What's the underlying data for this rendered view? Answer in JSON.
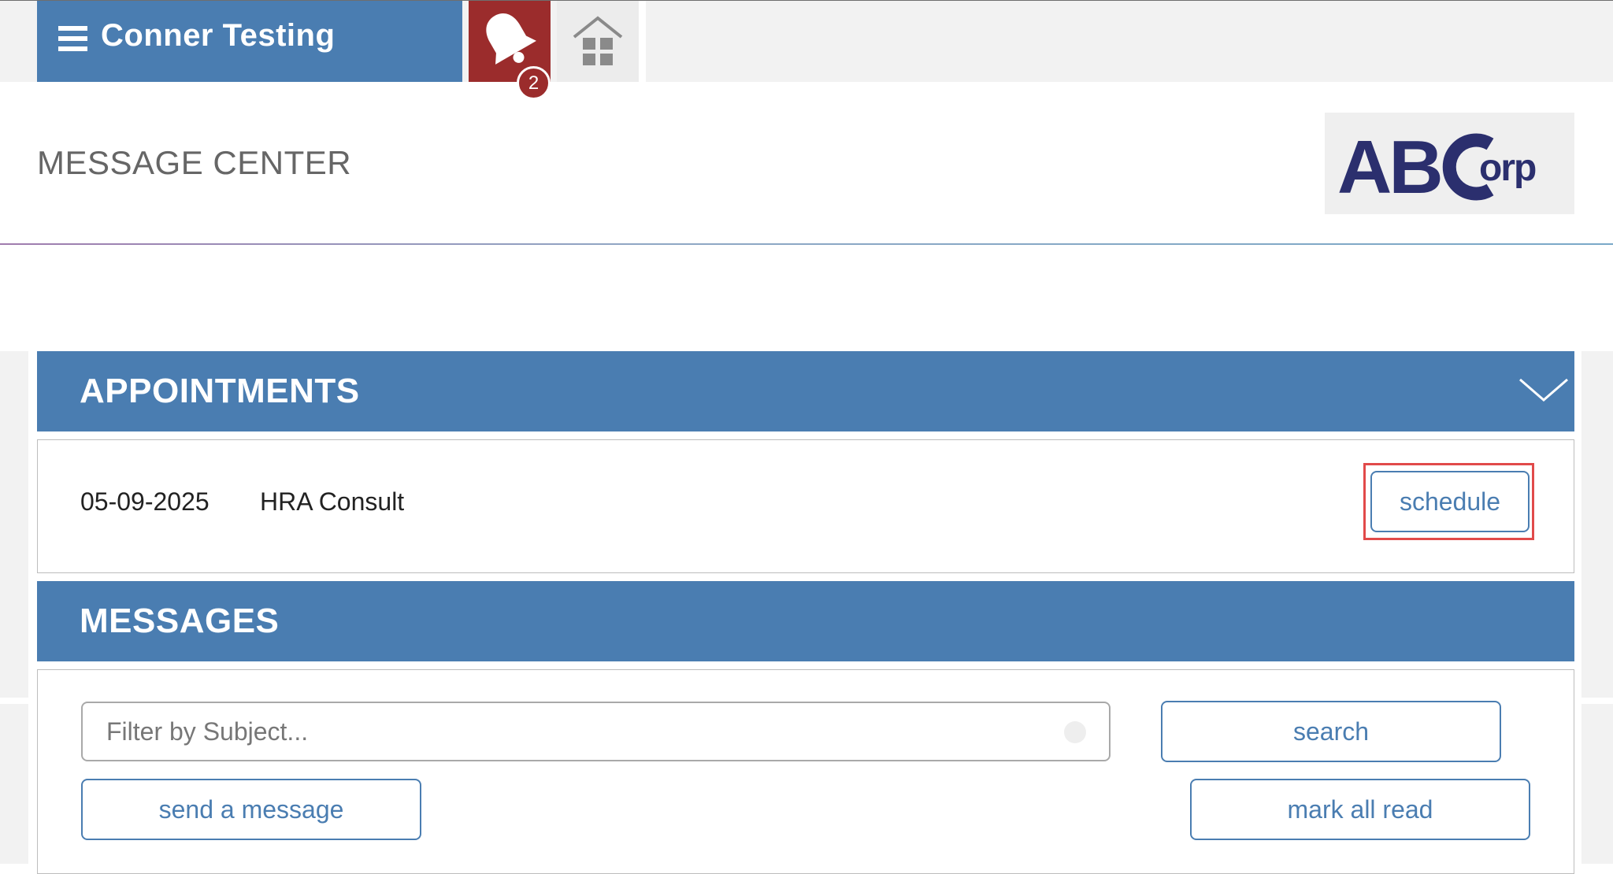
{
  "app": {
    "title": "Conner Testing",
    "notification_count": "2"
  },
  "header": {
    "page_title": "MESSAGE CENTER",
    "logo_text": "ABCorp"
  },
  "appointments": {
    "section_label": "APPOINTMENTS",
    "items": [
      {
        "date": "05-09-2025",
        "type": "HRA Consult",
        "action_label": "schedule"
      }
    ]
  },
  "messages": {
    "section_label": "MESSAGES",
    "filter_placeholder": "Filter by Subject...",
    "filter_value": "",
    "search_label": "search",
    "send_label": "send a message",
    "mark_read_label": "mark all read"
  },
  "colors": {
    "primary": "#4a7db1",
    "alert": "#9b2c2c",
    "highlight": "#e14a4a",
    "logo": "#2b2f6e"
  },
  "icons": [
    "menu-icon",
    "bell-icon",
    "home-icon",
    "chevron-down-icon",
    "clear-icon"
  ]
}
